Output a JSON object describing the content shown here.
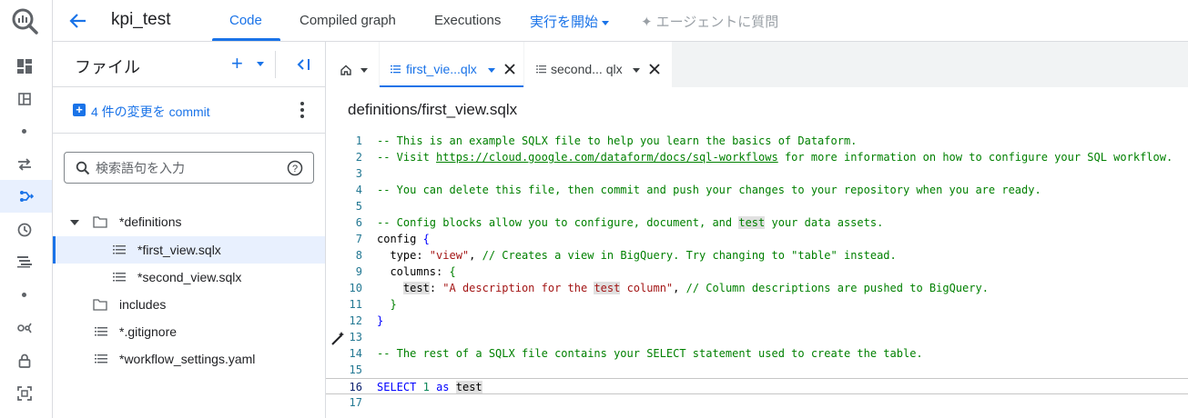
{
  "colors": {
    "accent": "#1a73e8",
    "selected_bg": "#e8f0fe",
    "comment": "#008000",
    "keyword": "#0000ff",
    "string": "#a31515"
  },
  "rail": {
    "icons": [
      "bigquery-logo-icon",
      "dashboard-icon",
      "panels-icon",
      "transfer-icon",
      "dataform-icon",
      "clock-icon",
      "list-icon",
      "analytics-icon",
      "lock-icon",
      "scan-icon"
    ],
    "active": "dataform-icon"
  },
  "header": {
    "title": "kpi_test",
    "tabs": [
      {
        "label": "Code",
        "active": true
      },
      {
        "label": "Compiled graph",
        "active": false
      },
      {
        "label": "Executions",
        "active": false
      }
    ],
    "run_label": "実行を開始",
    "agent_label": "エージェントに質問"
  },
  "files": {
    "title": "ファイル",
    "commit_label": "4 件の変更を commit",
    "search_placeholder": "検索語句を入力",
    "tree": [
      {
        "label": "*definitions",
        "type": "folder",
        "expanded": true
      },
      {
        "label": "*first_view.sqlx",
        "type": "file",
        "selected": true
      },
      {
        "label": "*second_view.sqlx",
        "type": "file"
      },
      {
        "label": "includes",
        "type": "folder"
      },
      {
        "label": "*.gitignore",
        "type": "file"
      },
      {
        "label": "*workflow_settings.yaml",
        "type": "file"
      }
    ]
  },
  "editor": {
    "tabs": [
      {
        "label": "first_vie...qlx",
        "active": true
      },
      {
        "label": "second... qlx",
        "active": false
      }
    ],
    "path": "definitions/first_view.sqlx",
    "current_line": 16,
    "lines": [
      {
        "n": "1",
        "tokens": [
          {
            "c": "cm",
            "t": "-- This is an example SQLX file to help you learn the basics of Dataform."
          }
        ]
      },
      {
        "n": "2",
        "tokens": [
          {
            "c": "cm",
            "t": "-- Visit "
          },
          {
            "c": "lnk",
            "t": "https://cloud.google.com/dataform/docs/sql-workflows"
          },
          {
            "c": "cm",
            "t": " for more information on how to configure your SQL workflow."
          }
        ]
      },
      {
        "n": "3",
        "tokens": []
      },
      {
        "n": "4",
        "tokens": [
          {
            "c": "cm",
            "t": "-- You can delete this file, then commit and push your changes to your repository when you are ready."
          }
        ]
      },
      {
        "n": "5",
        "tokens": []
      },
      {
        "n": "6",
        "tokens": [
          {
            "c": "cm",
            "t": "-- Config blocks allow you to configure, document, and "
          },
          {
            "c": "cm hl",
            "t": "test"
          },
          {
            "c": "cm",
            "t": " your data assets."
          }
        ]
      },
      {
        "n": "7",
        "tokens": [
          {
            "c": "pl",
            "t": "config "
          },
          {
            "c": "kw",
            "t": "{"
          }
        ]
      },
      {
        "n": "8",
        "tokens": [
          {
            "c": "pl",
            "t": "  type: "
          },
          {
            "c": "str",
            "t": "\"view\""
          },
          {
            "c": "pl",
            "t": ", "
          },
          {
            "c": "cm",
            "t": "// Creates a view in BigQuery. Try changing to \"table\" instead."
          }
        ]
      },
      {
        "n": "9",
        "tokens": [
          {
            "c": "pl",
            "t": "  columns: "
          },
          {
            "c": "cm",
            "t": "{"
          }
        ]
      },
      {
        "n": "10",
        "tokens": [
          {
            "c": "pl",
            "t": "    "
          },
          {
            "c": "pl hl",
            "t": "test"
          },
          {
            "c": "pl",
            "t": ": "
          },
          {
            "c": "str",
            "t": "\"A description for the "
          },
          {
            "c": "str hl",
            "t": "test"
          },
          {
            "c": "str",
            "t": " column\""
          },
          {
            "c": "pl",
            "t": ", "
          },
          {
            "c": "cm",
            "t": "// Column descriptions are pushed to BigQuery."
          }
        ]
      },
      {
        "n": "11",
        "tokens": [
          {
            "c": "pl",
            "t": "  "
          },
          {
            "c": "cm",
            "t": "}"
          }
        ]
      },
      {
        "n": "12",
        "tokens": [
          {
            "c": "kw",
            "t": "}"
          }
        ]
      },
      {
        "n": "13",
        "tokens": []
      },
      {
        "n": "14",
        "tokens": [
          {
            "c": "cm",
            "t": "-- The rest of a SQLX file contains your SELECT statement used to create the table."
          }
        ]
      },
      {
        "n": "15",
        "tokens": []
      },
      {
        "n": "16",
        "tokens": [
          {
            "c": "kw",
            "t": "SELECT"
          },
          {
            "c": "pl",
            "t": " "
          },
          {
            "c": "num",
            "t": "1"
          },
          {
            "c": "pl",
            "t": " "
          },
          {
            "c": "kw",
            "t": "as"
          },
          {
            "c": "pl",
            "t": " "
          },
          {
            "c": "pl hl",
            "t": "test"
          }
        ]
      },
      {
        "n": "17",
        "tokens": []
      }
    ]
  }
}
